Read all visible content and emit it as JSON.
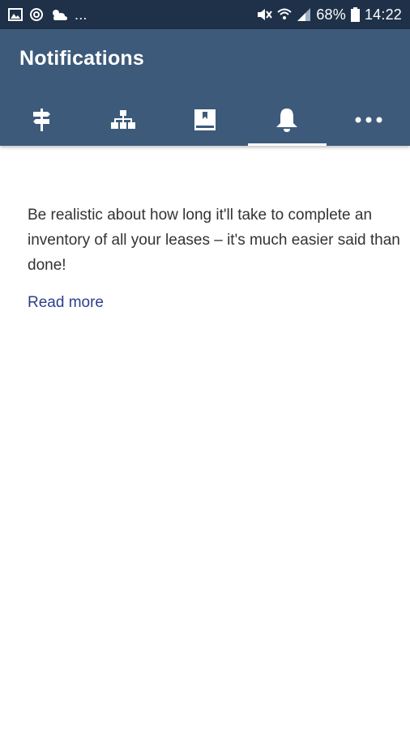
{
  "status_bar": {
    "battery": "68%",
    "time": "14:22",
    "overflow": "...",
    "icons": [
      "image-icon",
      "sync-icon",
      "weather-icon",
      "mute-icon",
      "wifi-icon",
      "signal-icon",
      "battery-icon"
    ]
  },
  "app_bar": {
    "title": "Notifications"
  },
  "tabs": [
    {
      "icon": "signpost-icon",
      "active": false
    },
    {
      "icon": "sitemap-icon",
      "active": false
    },
    {
      "icon": "book-icon",
      "active": false
    },
    {
      "icon": "bell-icon",
      "active": true
    },
    {
      "icon": "more-icon",
      "active": false
    }
  ],
  "notification": {
    "text": "Be realistic about how long it'll take to complete an inventory of all your leases – it's much easier said than done!",
    "link": "Read more"
  },
  "colors": {
    "status_bar": "#1f3148",
    "app_bar": "#3d5a7a",
    "link": "#2c3f8c",
    "text": "#333333"
  }
}
